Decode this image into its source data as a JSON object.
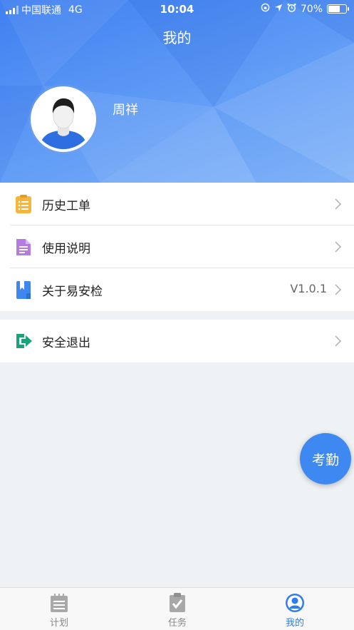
{
  "status_bar": {
    "carrier": "中国联通",
    "network": "4G",
    "time": "10:04",
    "battery_text": "70%",
    "battery_level": 0.7
  },
  "header": {
    "title": "我的",
    "user_name": "周祥",
    "bg_color": "#4a8af3"
  },
  "menu": {
    "history_label": "历史工单",
    "manual_label": "使用说明",
    "about_label": "关于易安检",
    "about_version": "V1.0.1",
    "logout_label": "安全退出"
  },
  "fab_label": "考勤",
  "tabs": [
    {
      "label": "计划",
      "icon": "calendar-icon"
    },
    {
      "label": "任务",
      "icon": "clipboard-check-icon"
    },
    {
      "label": "我的",
      "icon": "profile-icon"
    }
  ],
  "colors": {
    "accent": "#2f7cf0",
    "history_icon": "#f5b53f",
    "manual_icon": "#b57be0",
    "about_icon": "#3f86ef",
    "logout_icon": "#1aa37a"
  }
}
